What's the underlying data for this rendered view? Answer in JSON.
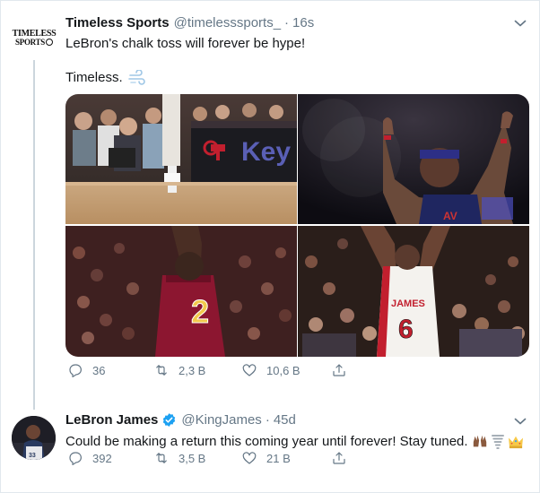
{
  "tweets": [
    {
      "author_name": "Timeless Sports",
      "handle": "@timelesssports_",
      "separator": "·",
      "time": "16s",
      "avatar_text_line1": "TIMELESS",
      "avatar_text_line2": "SPORTS",
      "text_line1": "LeBron's chalk toss will forever be hype!",
      "text_line2": "Timeless.",
      "text_line2_emoji": "dash-emoji",
      "media": [
        {
          "name": "courtside-sponsor-photo",
          "overlay_text": "Key"
        },
        {
          "name": "chalk-toss-cavaliers-photo"
        },
        {
          "name": "lebron-cavaliers-23-back-photo",
          "overlay_text": "2"
        },
        {
          "name": "lebron-heat-6-chalk-toss-photo",
          "overlay_text": "6"
        }
      ],
      "actions": {
        "replies": "36",
        "retweets": "2,3 B",
        "likes": "10,6 B"
      }
    },
    {
      "author_name": "LeBron James",
      "handle": "@KingJames",
      "separator": "·",
      "time": "45d",
      "verified": true,
      "text": "Could be making a return this coming year until forever! Stay tuned.",
      "emojis": [
        "raised-hands-emoji",
        "tornado-emoji",
        "crown-emoji"
      ],
      "actions": {
        "replies": "392",
        "retweets": "3,5 B",
        "likes": "21 B"
      }
    }
  ],
  "colors": {
    "text_primary": "#14171a",
    "text_secondary": "#657786",
    "verified_blue": "#1da1f2",
    "thread_line": "#ccd6dd",
    "border": "#e1e8ed"
  }
}
